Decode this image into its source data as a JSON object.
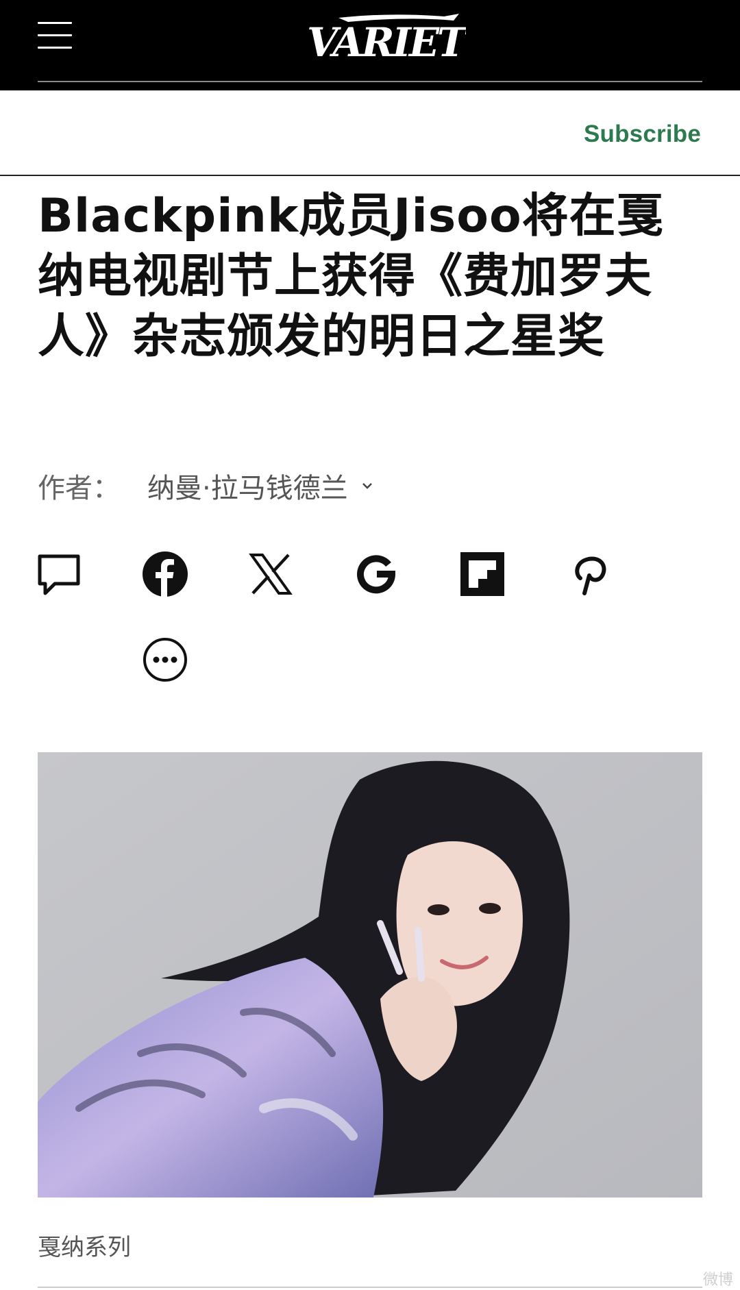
{
  "header": {
    "logo_text": "VARIETY",
    "menu_icon": "hamburger-menu-icon",
    "subscribe_label": "Subscribe",
    "accent_color": "#2d7a50"
  },
  "article": {
    "headline": "Blackpink成员Jisoo将在戛纳电视剧节上获得《费加罗夫人》杂志颁发的明日之星奖",
    "byline_label": "作者：",
    "byline_author": "纳曼·拉马钱德兰"
  },
  "share": [
    {
      "name": "comment",
      "icon": "comment-icon"
    },
    {
      "name": "facebook",
      "icon": "facebook-icon"
    },
    {
      "name": "x",
      "icon": "x-icon"
    },
    {
      "name": "google",
      "icon": "google-icon"
    },
    {
      "name": "flipboard",
      "icon": "flipboard-icon"
    },
    {
      "name": "pinterest",
      "icon": "pinterest-icon"
    },
    {
      "name": "more",
      "icon": "more-icon"
    }
  ],
  "image": {
    "caption": "戛纳系列"
  },
  "watermark": "微博"
}
